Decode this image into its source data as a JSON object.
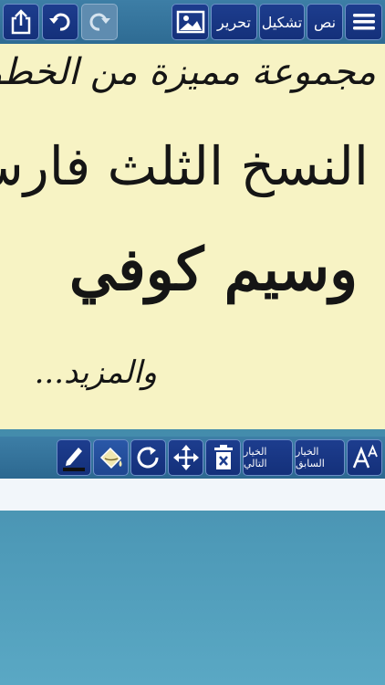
{
  "toolbar_top": {
    "text_label": "نص",
    "diacritics_label": "تشكيل",
    "edit_label": "تحرير"
  },
  "canvas": {
    "line1": "مجموعة مميزة من الخطوط",
    "line2": "النسخ الثلث فارسي",
    "line3": "وسيم كوفي",
    "line4": "والمزيد..."
  },
  "toolbar_bottom": {
    "previous_label": "الخيار السابق",
    "next_label": "الخيار التالي"
  },
  "colors": {
    "button_bg": "#1d3d8e",
    "canvas_bg": "#f7f3c4",
    "bar_bg": "#3d7ea6"
  }
}
